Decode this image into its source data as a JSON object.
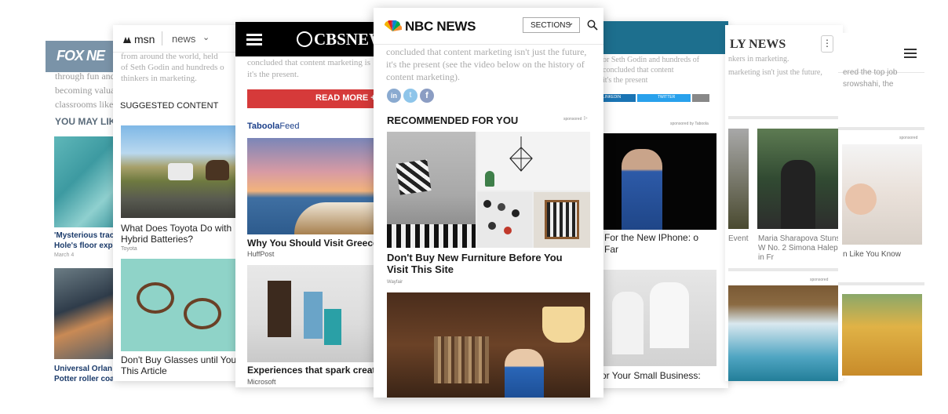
{
  "fox": {
    "logo": "FOX NE",
    "text_lines": [
      "through fun and",
      "becoming valua",
      "classrooms like"
    ],
    "section": "YOU MAY LIK",
    "item1_head": "'Mysterious trac Hole's floor exp",
    "item1_date": "March 4",
    "item2_head": "Universal Orlan Potter roller coa"
  },
  "msn": {
    "logo": "msn",
    "section": "news",
    "text_lines": [
      "from around the world, held",
      "of Seth Godin and hundreds o",
      "thinkers in marketing."
    ],
    "suggested": "SUGGESTED CONTENT",
    "item1_head": "What Does Toyota Do with Hybrid Batteries?",
    "item1_src": "Toyota",
    "item2_head": "Don't Buy Glasses until You This Article"
  },
  "cbs": {
    "logo": "CBSNEW",
    "text_lines": [
      "concluded that content marketing is",
      "it's the present."
    ],
    "read_more": "READ MORE +",
    "taboola": "Taboola",
    "feed": "Feed",
    "item1_head": "Why You Should Visit Greece",
    "item1_src": "HuffPost",
    "item2_head": "Experiences that spark creati",
    "item2_src": "Microsoft"
  },
  "nbc": {
    "logo": "NBC NEWS",
    "sections": "SECTIONS",
    "text_lines": [
      "concluded that content marketing isn't just the future,",
      "it's the present (see the video below on the history of",
      "content marketing)."
    ],
    "recommended": "RECOMMENDED FOR YOU",
    "sponsored": "sponsored",
    "item1_head": "Don't Buy New Furniture Before You Visit This Site",
    "item1_src": "Wayfair"
  },
  "card5": {
    "text_lines": [
      "or Seth Godin and hundreds of",
      "concluded that content",
      "it's the present"
    ],
    "share_linkedin": "LINKEDIN",
    "share_twitter": "TWITTER",
    "sponsored": "sponsored by Taboola",
    "item1_head": "For the New IPhone: o Far",
    "item2_head": "or Your Small Business:"
  },
  "daily": {
    "logo": "LY NEWS",
    "text_lines": [
      "nkers in marketing.",
      "marketing isn't just the future,"
    ],
    "item1_head": "Event",
    "item2_head": "Maria Sharapova Stuns W No. 2 Simona Halep in Fr",
    "sponsored": "sponsored"
  },
  "card7": {
    "text_lines": [
      "ered the top job",
      "srowshahi, the"
    ],
    "sponsored": "sponsored",
    "item1_head": "n Like You Know"
  }
}
